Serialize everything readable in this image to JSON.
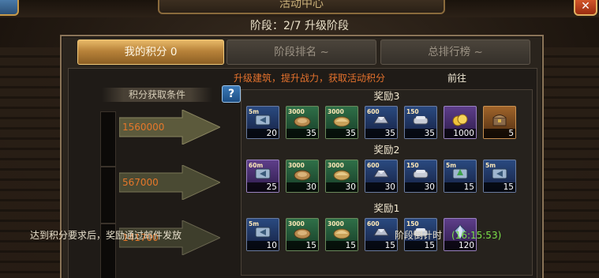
{
  "header": {
    "title_partial": "活动中心",
    "stage_text": "阶段：2/7 升级阶段",
    "close_glyph": "✕"
  },
  "tabs": [
    {
      "label": "我的积分 0",
      "active": true
    },
    {
      "label": "阶段排名 ~",
      "active": false
    },
    {
      "label": "总排行榜 ~",
      "active": false
    }
  ],
  "notice": {
    "text": "升级建筑，提升战力，获取活动积分",
    "goto_label": "前往"
  },
  "conditions": {
    "label": "积分获取条件",
    "help_glyph": "?"
  },
  "tiers": [
    {
      "score": "1560000",
      "title": "奖励3",
      "items": [
        {
          "style": "blue",
          "tag": "5m",
          "icon": "speedup-icon",
          "count": "20"
        },
        {
          "style": "green",
          "tag": "3000",
          "icon": "wood-icon",
          "count": "35"
        },
        {
          "style": "green",
          "tag": "3000",
          "icon": "food-icon",
          "count": "35"
        },
        {
          "style": "blue",
          "tag": "600",
          "icon": "iron-icon",
          "count": "35"
        },
        {
          "style": "blue",
          "tag": "150",
          "icon": "silver-icon",
          "count": "35"
        },
        {
          "style": "purple",
          "tag": "",
          "icon": "gold-coins-icon",
          "count": "1000"
        },
        {
          "style": "orange",
          "tag": "",
          "icon": "chest-icon",
          "count": "5"
        }
      ]
    },
    {
      "score": "567000",
      "title": "奖励2",
      "items": [
        {
          "style": "purple",
          "tag": "60m",
          "icon": "speedup-icon",
          "count": "25"
        },
        {
          "style": "green",
          "tag": "3000",
          "icon": "wood-icon",
          "count": "30"
        },
        {
          "style": "green",
          "tag": "3000",
          "icon": "food-icon",
          "count": "30"
        },
        {
          "style": "blue",
          "tag": "600",
          "icon": "iron-icon",
          "count": "30"
        },
        {
          "style": "blue",
          "tag": "150",
          "icon": "silver-icon",
          "count": "30"
        },
        {
          "style": "blue",
          "tag": "5m",
          "icon": "build-speedup-icon",
          "count": "15"
        },
        {
          "style": "blue",
          "tag": "5m",
          "icon": "speedup-icon",
          "count": "15"
        }
      ]
    },
    {
      "score": "141700",
      "title": "奖励1",
      "items": [
        {
          "style": "blue",
          "tag": "5m",
          "icon": "speedup-icon",
          "count": "10"
        },
        {
          "style": "green",
          "tag": "3000",
          "icon": "wood-icon",
          "count": "15"
        },
        {
          "style": "green",
          "tag": "3000",
          "icon": "food-icon",
          "count": "15"
        },
        {
          "style": "blue",
          "tag": "600",
          "icon": "iron-icon",
          "count": "15"
        },
        {
          "style": "blue",
          "tag": "150",
          "icon": "silver-icon",
          "count": "15"
        },
        {
          "style": "purple",
          "tag": "",
          "icon": "crystal-icon",
          "count": "120"
        }
      ]
    }
  ],
  "footer": {
    "note": "达到积分要求后，奖励通过邮件发放",
    "countdown_label": "阶段倒计时",
    "countdown_value": "(16:15:53)"
  },
  "colors": {
    "accent_orange": "#e6772a",
    "countdown_green": "#7be04a",
    "active_tab_gold": "#c08a3e"
  }
}
